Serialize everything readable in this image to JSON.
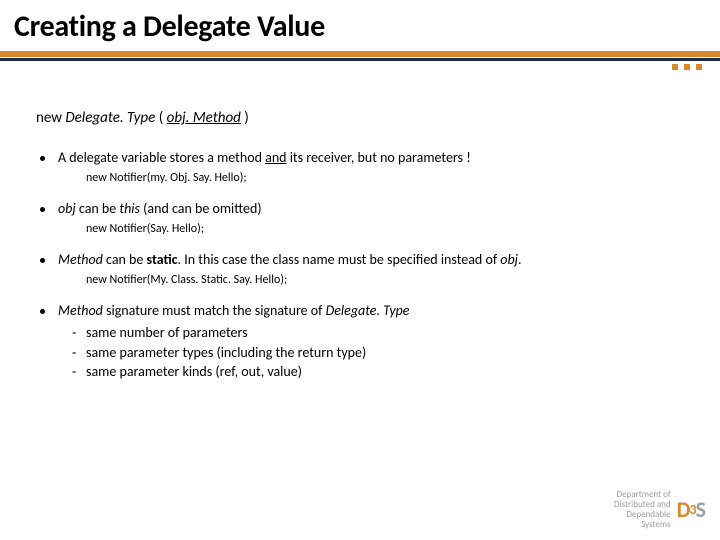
{
  "title": "Creating a Delegate Value",
  "syntax": {
    "kw_new": "new",
    "delegate_type": "Delegate. Type",
    "lparen": " (",
    "obj_dot_method": "obj. Method",
    "rparen": ")"
  },
  "bullets": [
    {
      "prefix": "A delegate variable stores a method ",
      "underlined": "and",
      "suffix": " its receiver, but no parameters !",
      "code": "new Notifier(my. Obj. Say. Hello);"
    },
    {
      "italic1": "obj",
      "mid1": " can be ",
      "italic2": "this",
      "suffix": " (and can be omitted)",
      "code": "new Notifier(Say. Hello);"
    },
    {
      "italic1": "Method",
      "mid1": " can be ",
      "bold1": "static",
      "mid2": ". In this case the class name must be specified instead of ",
      "italic2": "obj",
      "suffix": ".",
      "code": "new Notifier(My. Class. Static. Say. Hello);"
    },
    {
      "italic1": "Method",
      "mid1": " signature must match the signature of ",
      "italic2": "Delegate. Type",
      "sub": [
        "same number of parameters",
        "same parameter types (including the return type)",
        "same parameter kinds (ref, out, value)"
      ]
    }
  ],
  "footer": {
    "line1": "Department of",
    "line2": "Distributed and",
    "line3": "Dependable",
    "line4": "Systems",
    "logo_d": "D",
    "logo_3": "3",
    "logo_s": "S"
  }
}
